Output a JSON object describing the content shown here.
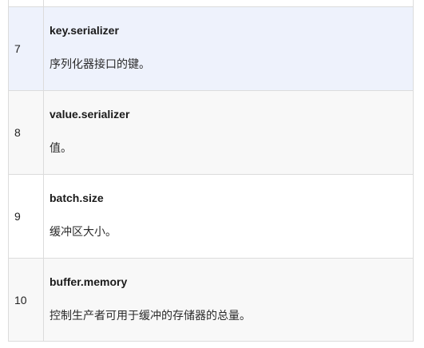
{
  "rows": [
    {
      "num": "7",
      "key": "key.serializer",
      "desc": "序列化器接口的键。"
    },
    {
      "num": "8",
      "key": "value.serializer",
      "desc": "值。"
    },
    {
      "num": "9",
      "key": "batch.size",
      "desc": "缓冲区大小。"
    },
    {
      "num": "10",
      "key": "buffer.memory",
      "desc": "控制生产者可用于缓冲的存储器的总量。"
    }
  ]
}
